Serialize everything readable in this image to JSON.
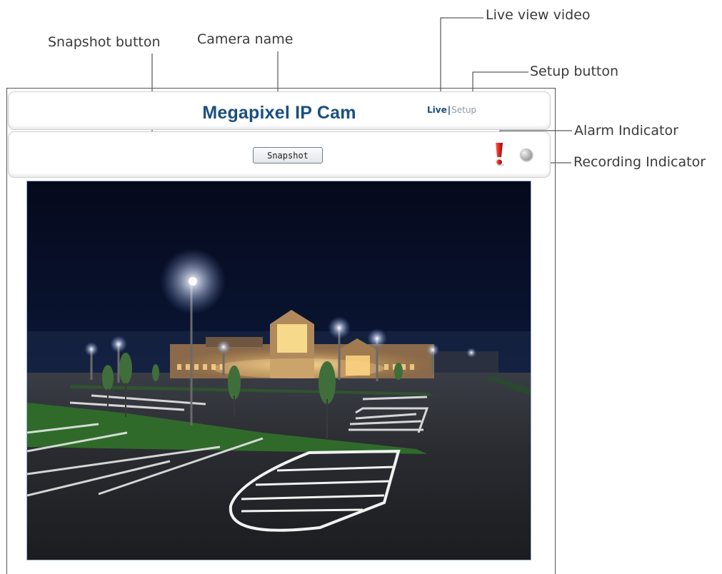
{
  "annotations": {
    "live_view_video": "Live view video",
    "snapshot_button": "Snapshot button",
    "camera_name": "Camera name",
    "setup_button": "Setup button",
    "alarm_indicator": "Alarm Indicator",
    "recording_indicator": "Recording Indicator"
  },
  "header": {
    "camera_name": "Megapixel IP Cam",
    "nav_live": "Live",
    "nav_separator": "|",
    "nav_setup": "Setup"
  },
  "toolbar": {
    "snapshot_label": "Snapshot",
    "alarm_icon": "alarm-exclamation-icon",
    "recording_icon": "recording-indicator-icon"
  },
  "colors": {
    "camera_name": "#1a4f80",
    "alarm": "#d9221e",
    "video_border": "#9db6d8"
  },
  "video": {
    "scene": "night-parking-lot"
  }
}
